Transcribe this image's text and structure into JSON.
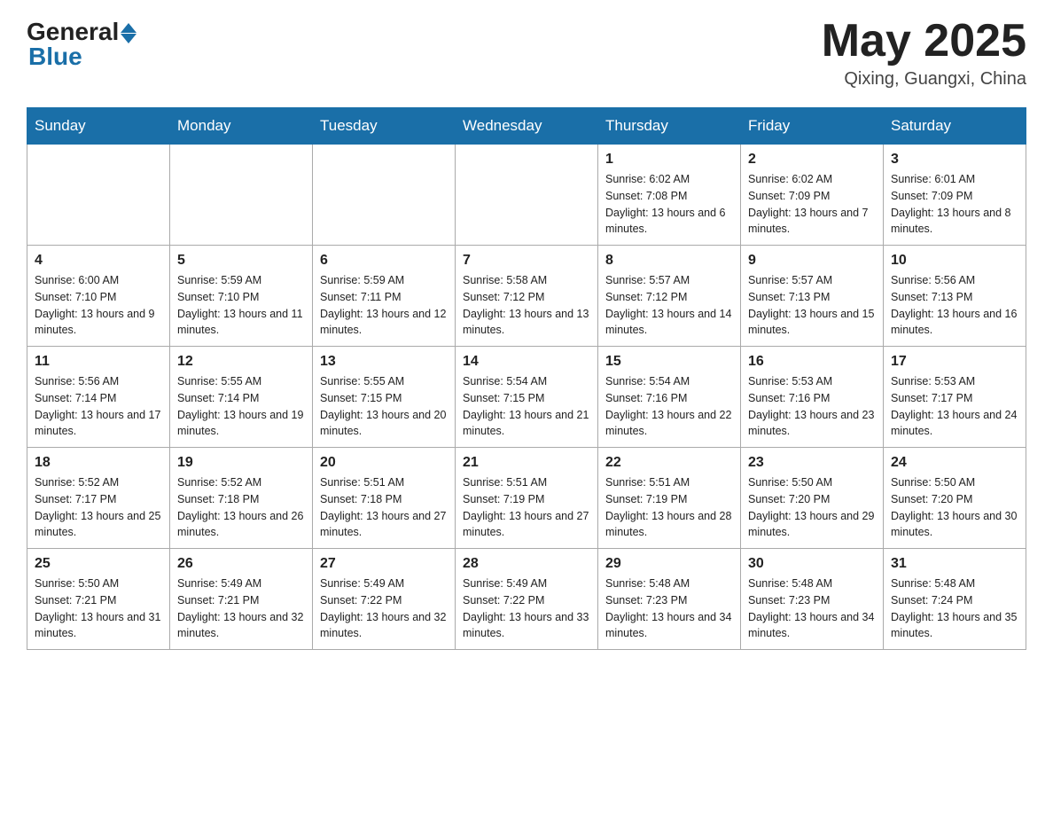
{
  "header": {
    "logo_general": "General",
    "logo_blue": "Blue",
    "month_title": "May 2025",
    "location": "Qixing, Guangxi, China"
  },
  "days_of_week": [
    "Sunday",
    "Monday",
    "Tuesday",
    "Wednesday",
    "Thursday",
    "Friday",
    "Saturday"
  ],
  "weeks": [
    [
      {
        "day": "",
        "info": ""
      },
      {
        "day": "",
        "info": ""
      },
      {
        "day": "",
        "info": ""
      },
      {
        "day": "",
        "info": ""
      },
      {
        "day": "1",
        "info": "Sunrise: 6:02 AM\nSunset: 7:08 PM\nDaylight: 13 hours and 6 minutes."
      },
      {
        "day": "2",
        "info": "Sunrise: 6:02 AM\nSunset: 7:09 PM\nDaylight: 13 hours and 7 minutes."
      },
      {
        "day": "3",
        "info": "Sunrise: 6:01 AM\nSunset: 7:09 PM\nDaylight: 13 hours and 8 minutes."
      }
    ],
    [
      {
        "day": "4",
        "info": "Sunrise: 6:00 AM\nSunset: 7:10 PM\nDaylight: 13 hours and 9 minutes."
      },
      {
        "day": "5",
        "info": "Sunrise: 5:59 AM\nSunset: 7:10 PM\nDaylight: 13 hours and 11 minutes."
      },
      {
        "day": "6",
        "info": "Sunrise: 5:59 AM\nSunset: 7:11 PM\nDaylight: 13 hours and 12 minutes."
      },
      {
        "day": "7",
        "info": "Sunrise: 5:58 AM\nSunset: 7:12 PM\nDaylight: 13 hours and 13 minutes."
      },
      {
        "day": "8",
        "info": "Sunrise: 5:57 AM\nSunset: 7:12 PM\nDaylight: 13 hours and 14 minutes."
      },
      {
        "day": "9",
        "info": "Sunrise: 5:57 AM\nSunset: 7:13 PM\nDaylight: 13 hours and 15 minutes."
      },
      {
        "day": "10",
        "info": "Sunrise: 5:56 AM\nSunset: 7:13 PM\nDaylight: 13 hours and 16 minutes."
      }
    ],
    [
      {
        "day": "11",
        "info": "Sunrise: 5:56 AM\nSunset: 7:14 PM\nDaylight: 13 hours and 17 minutes."
      },
      {
        "day": "12",
        "info": "Sunrise: 5:55 AM\nSunset: 7:14 PM\nDaylight: 13 hours and 19 minutes."
      },
      {
        "day": "13",
        "info": "Sunrise: 5:55 AM\nSunset: 7:15 PM\nDaylight: 13 hours and 20 minutes."
      },
      {
        "day": "14",
        "info": "Sunrise: 5:54 AM\nSunset: 7:15 PM\nDaylight: 13 hours and 21 minutes."
      },
      {
        "day": "15",
        "info": "Sunrise: 5:54 AM\nSunset: 7:16 PM\nDaylight: 13 hours and 22 minutes."
      },
      {
        "day": "16",
        "info": "Sunrise: 5:53 AM\nSunset: 7:16 PM\nDaylight: 13 hours and 23 minutes."
      },
      {
        "day": "17",
        "info": "Sunrise: 5:53 AM\nSunset: 7:17 PM\nDaylight: 13 hours and 24 minutes."
      }
    ],
    [
      {
        "day": "18",
        "info": "Sunrise: 5:52 AM\nSunset: 7:17 PM\nDaylight: 13 hours and 25 minutes."
      },
      {
        "day": "19",
        "info": "Sunrise: 5:52 AM\nSunset: 7:18 PM\nDaylight: 13 hours and 26 minutes."
      },
      {
        "day": "20",
        "info": "Sunrise: 5:51 AM\nSunset: 7:18 PM\nDaylight: 13 hours and 27 minutes."
      },
      {
        "day": "21",
        "info": "Sunrise: 5:51 AM\nSunset: 7:19 PM\nDaylight: 13 hours and 27 minutes."
      },
      {
        "day": "22",
        "info": "Sunrise: 5:51 AM\nSunset: 7:19 PM\nDaylight: 13 hours and 28 minutes."
      },
      {
        "day": "23",
        "info": "Sunrise: 5:50 AM\nSunset: 7:20 PM\nDaylight: 13 hours and 29 minutes."
      },
      {
        "day": "24",
        "info": "Sunrise: 5:50 AM\nSunset: 7:20 PM\nDaylight: 13 hours and 30 minutes."
      }
    ],
    [
      {
        "day": "25",
        "info": "Sunrise: 5:50 AM\nSunset: 7:21 PM\nDaylight: 13 hours and 31 minutes."
      },
      {
        "day": "26",
        "info": "Sunrise: 5:49 AM\nSunset: 7:21 PM\nDaylight: 13 hours and 32 minutes."
      },
      {
        "day": "27",
        "info": "Sunrise: 5:49 AM\nSunset: 7:22 PM\nDaylight: 13 hours and 32 minutes."
      },
      {
        "day": "28",
        "info": "Sunrise: 5:49 AM\nSunset: 7:22 PM\nDaylight: 13 hours and 33 minutes."
      },
      {
        "day": "29",
        "info": "Sunrise: 5:48 AM\nSunset: 7:23 PM\nDaylight: 13 hours and 34 minutes."
      },
      {
        "day": "30",
        "info": "Sunrise: 5:48 AM\nSunset: 7:23 PM\nDaylight: 13 hours and 34 minutes."
      },
      {
        "day": "31",
        "info": "Sunrise: 5:48 AM\nSunset: 7:24 PM\nDaylight: 13 hours and 35 minutes."
      }
    ]
  ]
}
